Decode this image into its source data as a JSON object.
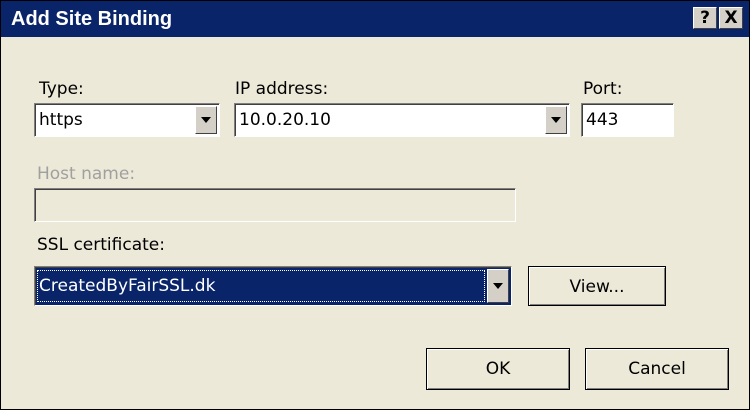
{
  "window": {
    "title": "Add Site Binding",
    "help_button": "?",
    "close_button": "X"
  },
  "type": {
    "label": "Type:",
    "value": "https"
  },
  "ip_address": {
    "label": "IP address:",
    "value": "10.0.20.10"
  },
  "port": {
    "label": "Port:",
    "value": "443"
  },
  "host_name": {
    "label": "Host name:",
    "value": ""
  },
  "ssl_certificate": {
    "label": "SSL certificate:",
    "value": "CreatedByFairSSL.dk"
  },
  "buttons": {
    "view": "View...",
    "ok": "OK",
    "cancel": "Cancel"
  },
  "colors": {
    "titlebar": "#0a246a",
    "dialog_bg": "#ece9d8",
    "selection": "#0a246a"
  },
  "icons": {
    "dropdown": "chevron-down-icon"
  }
}
